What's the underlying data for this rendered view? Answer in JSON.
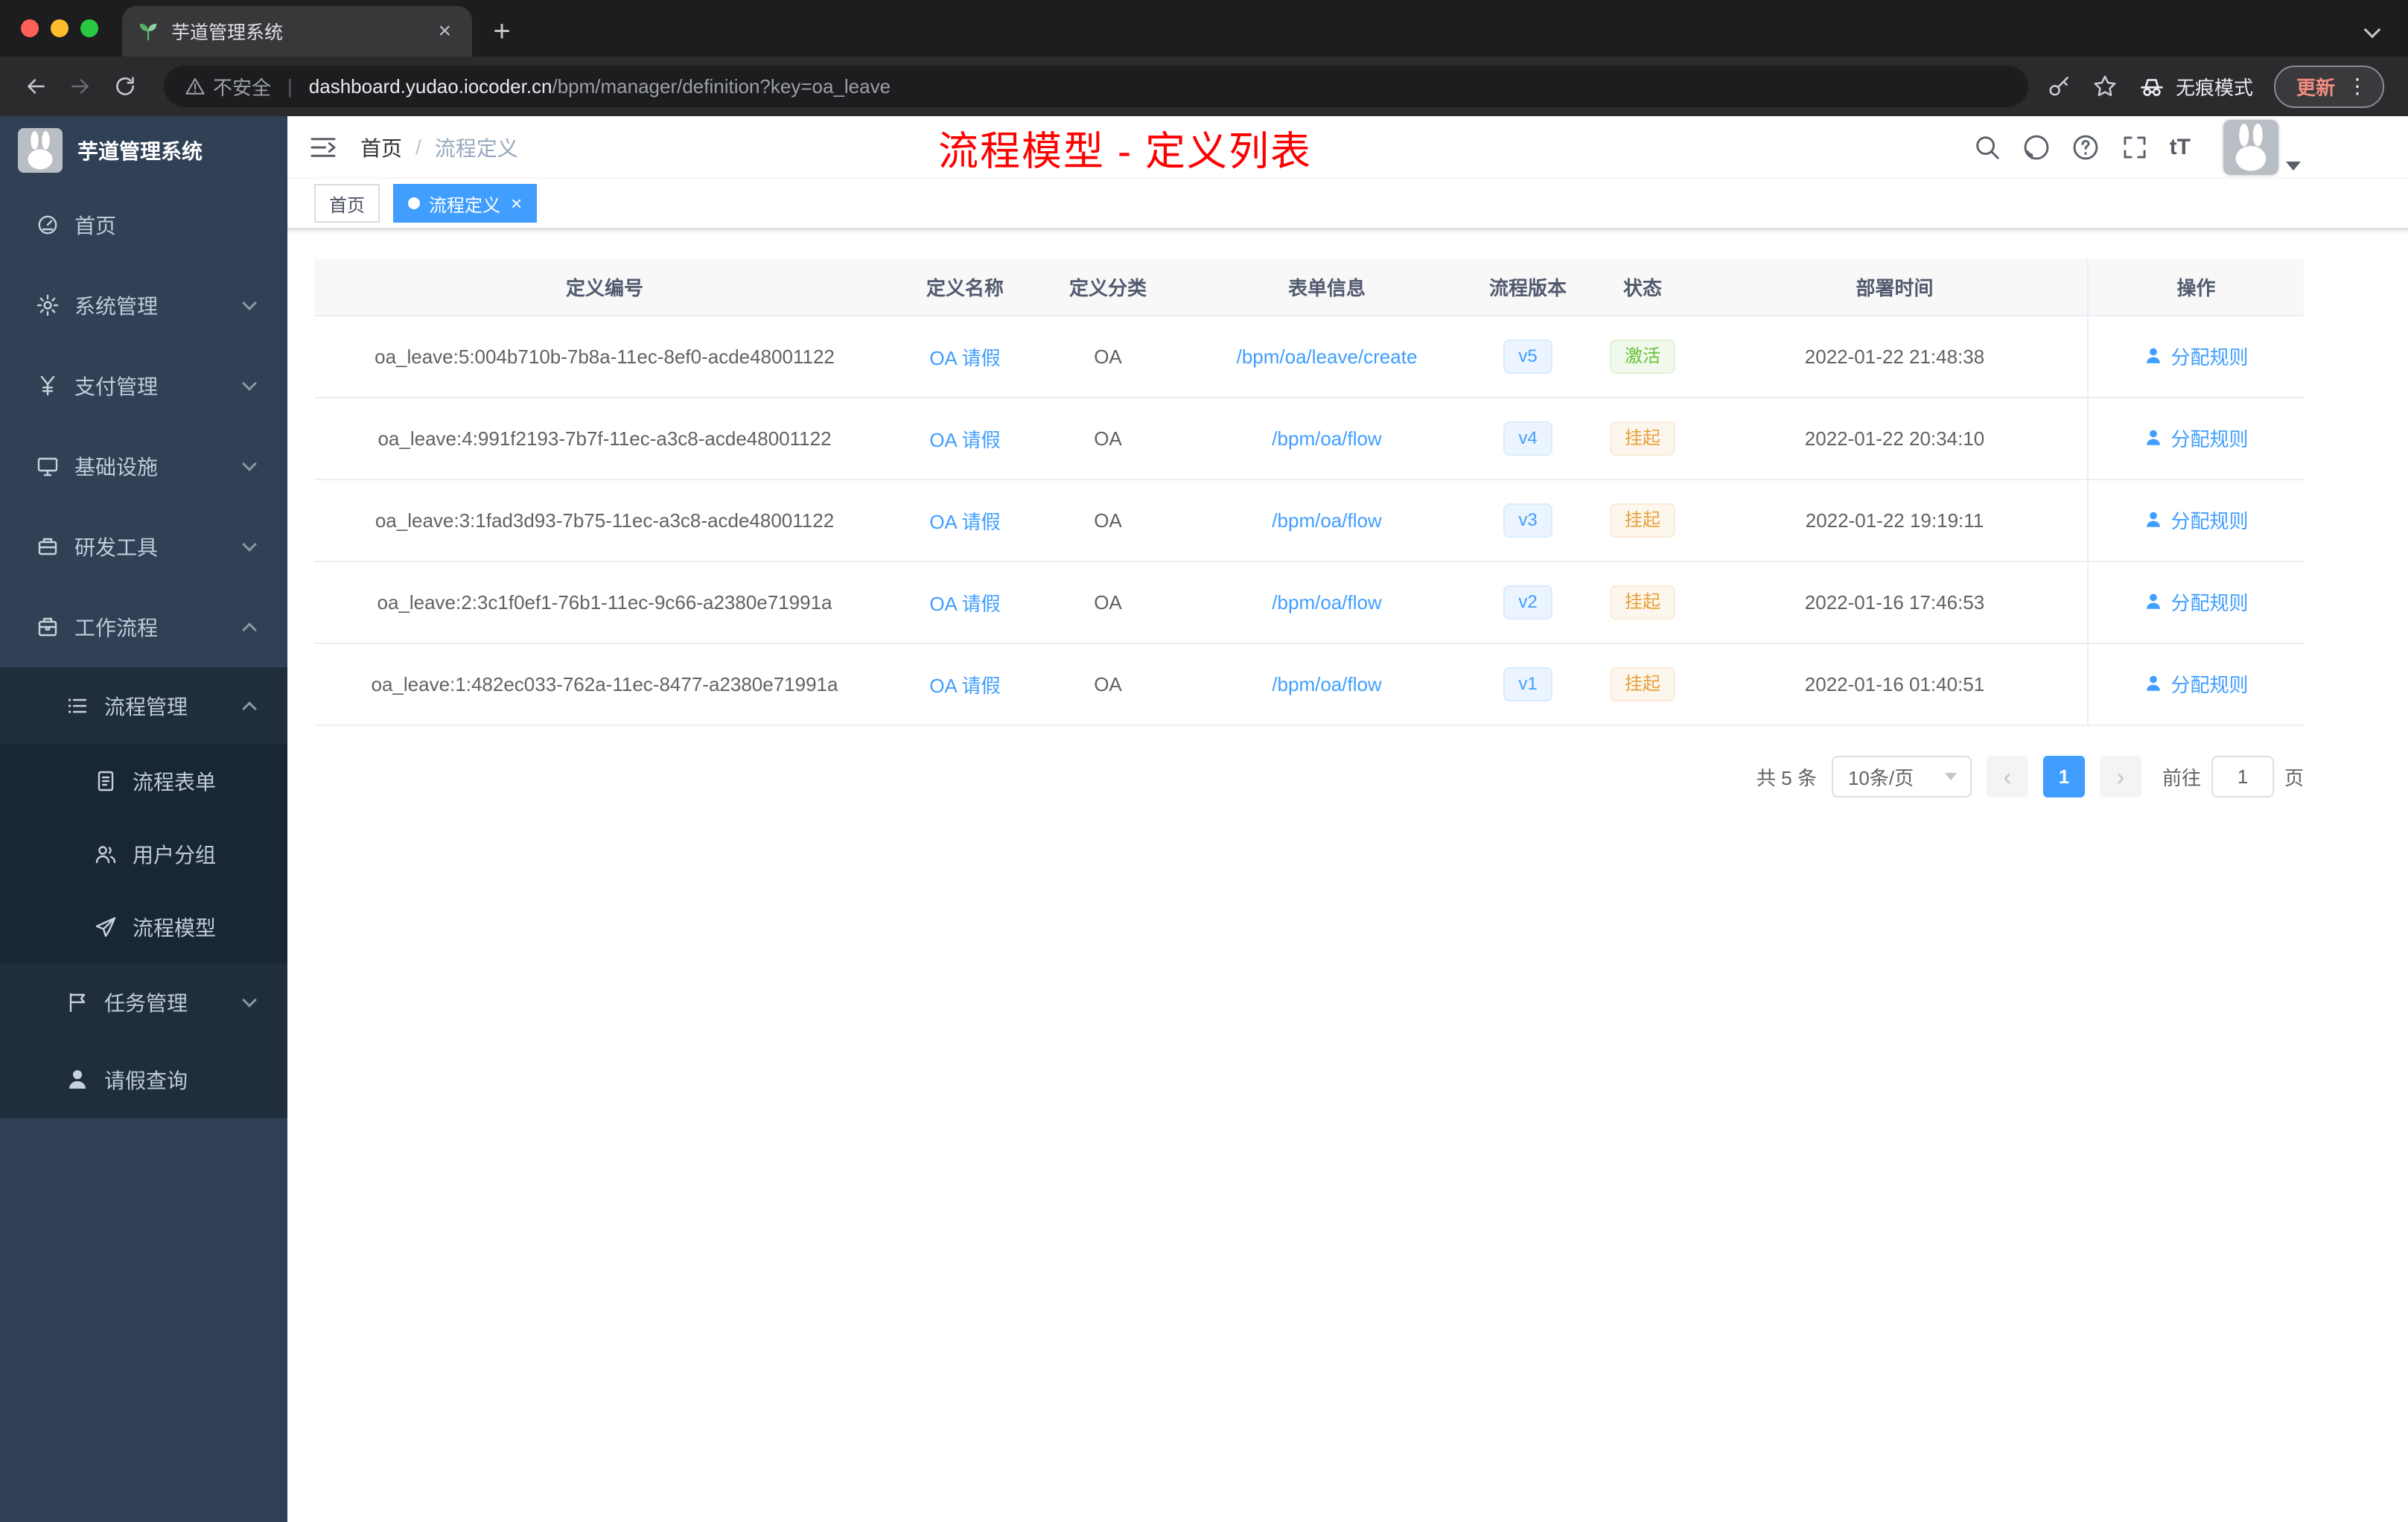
{
  "browser": {
    "tab_title": "芋道管理系统",
    "url_security": "不安全",
    "url_domain": "dashboard.yudao.iocoder.cn",
    "url_path": "/bpm/manager/definition?key=oa_leave",
    "incognito_label": "无痕模式",
    "update_button": "更新"
  },
  "sidebar": {
    "brand": "芋道管理系统",
    "menu": [
      {
        "key": "home",
        "icon": "gauge",
        "label": "首页"
      },
      {
        "key": "system-mgmt",
        "icon": "gear",
        "label": "系统管理",
        "caret": "down"
      },
      {
        "key": "payment-mgmt",
        "icon": "yen",
        "label": "支付管理",
        "caret": "down"
      },
      {
        "key": "infrastructure",
        "icon": "monitor",
        "label": "基础设施",
        "caret": "down"
      },
      {
        "key": "dev-tools",
        "icon": "toolbox",
        "label": "研发工具",
        "caret": "down"
      },
      {
        "key": "workflow",
        "icon": "briefcase",
        "label": "工作流程",
        "caret": "up",
        "children": [
          {
            "key": "process-mgmt",
            "icon": "list",
            "label": "流程管理",
            "caret": "up",
            "children": [
              {
                "key": "process-form",
                "icon": "doc",
                "label": "流程表单"
              },
              {
                "key": "user-group",
                "icon": "users",
                "label": "用户分组"
              },
              {
                "key": "process-model",
                "icon": "plane",
                "label": "流程模型"
              }
            ]
          },
          {
            "key": "task-mgmt",
            "icon": "flag",
            "label": "任务管理",
            "caret": "down"
          },
          {
            "key": "leave-query",
            "icon": "person",
            "label": "请假查询"
          }
        ]
      }
    ]
  },
  "header": {
    "breadcrumb": [
      "首页",
      "流程定义"
    ],
    "overlay_title": "流程模型 - 定义列表"
  },
  "tags": {
    "items": [
      {
        "label": "首页",
        "active": false
      },
      {
        "label": "流程定义",
        "active": true
      }
    ]
  },
  "table": {
    "headers": [
      "定义编号",
      "定义名称",
      "定义分类",
      "表单信息",
      "流程版本",
      "状态",
      "部署时间",
      "操作"
    ],
    "action_label": "分配规则",
    "rows": [
      {
        "id": "oa_leave:5:004b710b-7b8a-11ec-8ef0-acde48001122",
        "name": "OA 请假",
        "category": "OA",
        "form": "/bpm/oa/leave/create",
        "version": "v5",
        "status": "激活",
        "status_type": "success",
        "time": "2022-01-22 21:48:38"
      },
      {
        "id": "oa_leave:4:991f2193-7b7f-11ec-a3c8-acde48001122",
        "name": "OA 请假",
        "category": "OA",
        "form": "/bpm/oa/flow",
        "version": "v4",
        "status": "挂起",
        "status_type": "warning",
        "time": "2022-01-22 20:34:10"
      },
      {
        "id": "oa_leave:3:1fad3d93-7b75-11ec-a3c8-acde48001122",
        "name": "OA 请假",
        "category": "OA",
        "form": "/bpm/oa/flow",
        "version": "v3",
        "status": "挂起",
        "status_type": "warning",
        "time": "2022-01-22 19:19:11"
      },
      {
        "id": "oa_leave:2:3c1f0ef1-76b1-11ec-9c66-a2380e71991a",
        "name": "OA 请假",
        "category": "OA",
        "form": "/bpm/oa/flow",
        "version": "v2",
        "status": "挂起",
        "status_type": "warning",
        "time": "2022-01-16 17:46:53"
      },
      {
        "id": "oa_leave:1:482ec033-762a-11ec-8477-a2380e71991a",
        "name": "OA 请假",
        "category": "OA",
        "form": "/bpm/oa/flow",
        "version": "v1",
        "status": "挂起",
        "status_type": "warning",
        "time": "2022-01-16 01:40:51"
      }
    ]
  },
  "pagination": {
    "total_text": "共 5 条",
    "page_size": "10条/页",
    "current_page": "1",
    "goto_prefix": "前往",
    "goto_value": "1",
    "goto_suffix": "页"
  },
  "colors": {
    "accent_blue": "#409eff",
    "success_green": "#67c23a",
    "warning_orange": "#e6a23c",
    "overlay_red": "#fe0000",
    "sidebar_bg": "#304156",
    "submenu_bg": "#1f2d3d"
  }
}
